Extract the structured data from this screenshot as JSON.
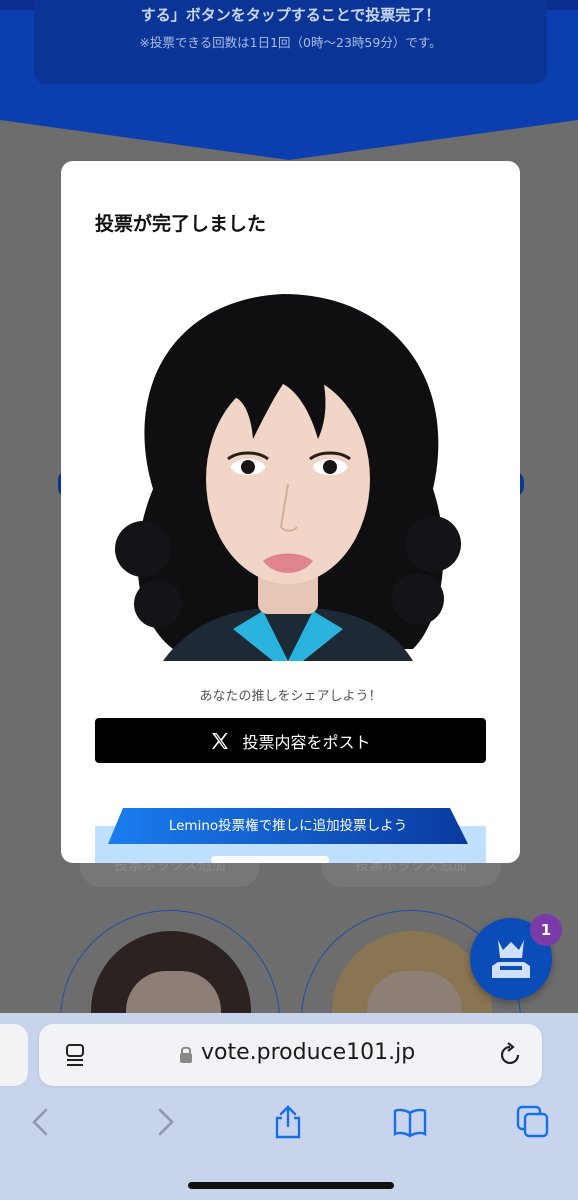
{
  "background": {
    "info_line1": "する」ボタンをタップすることで投票完了！",
    "info_line2": "※投票できる回数は1日1回（0時〜23時59分）です。",
    "add_box_left": "投票ボックス追加",
    "add_box_right": "投票ボックス追加",
    "ballot_badge_count": "1"
  },
  "modal": {
    "title": "投票が完了しました",
    "share_caption": "あなたの推しをシェアしよう！",
    "post_button_label": "投票内容をポスト",
    "lemino_banner": "Lemino投票権で推しに追加投票しよう"
  },
  "browser": {
    "url": "vote.produce101.jp"
  },
  "colors": {
    "brand_blue": "#0b3fb0",
    "post_button": "#000000",
    "lemino_gradient_start": "#1a7df0",
    "lemino_gradient_end": "#0a3a9f"
  }
}
